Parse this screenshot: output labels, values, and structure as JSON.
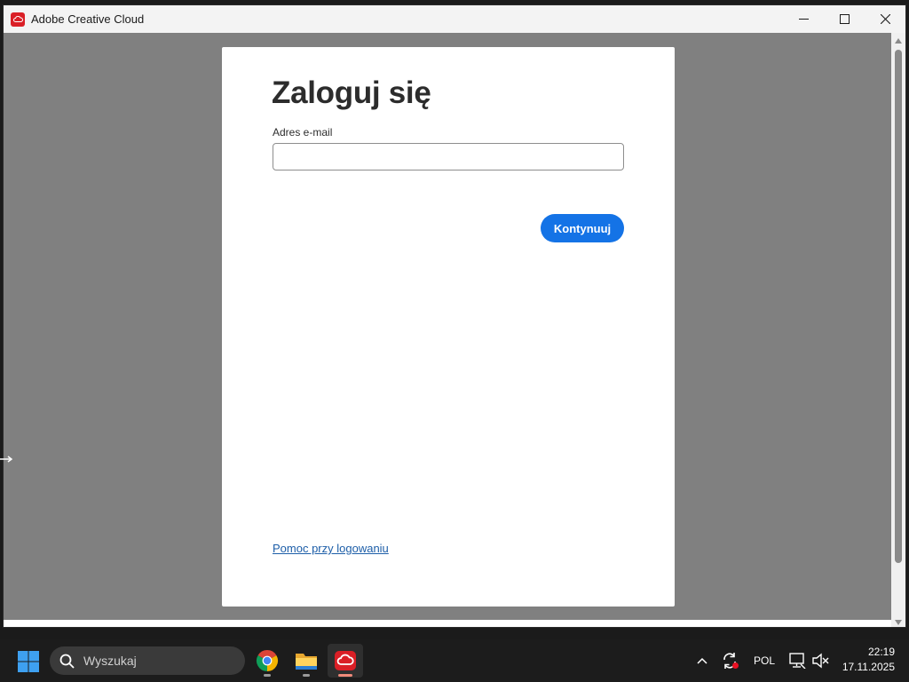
{
  "window": {
    "title": "Adobe Creative Cloud",
    "controls": [
      "minimize-icon",
      "maximize-icon",
      "close-icon"
    ]
  },
  "login": {
    "title": "Zaloguj się",
    "email_label": "Adres e-mail",
    "email_value": "",
    "continue_label": "Kontynuuj",
    "help_link": "Pomoc przy logowaniu"
  },
  "taskbar": {
    "search_placeholder": "Wyszukaj",
    "apps": [
      "chrome-icon",
      "file-explorer-icon",
      "adobe-creative-cloud-icon"
    ],
    "language": "POL",
    "time": "22:19",
    "date": "17.11.2025"
  },
  "colors": {
    "accent": "#1473e6",
    "adobe_red": "#da1f26",
    "link": "#1d5ea8",
    "backdrop": "#808080"
  }
}
